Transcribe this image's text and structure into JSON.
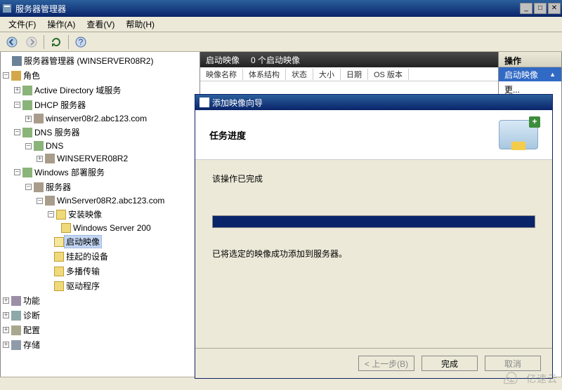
{
  "window": {
    "title": "服务器管理器"
  },
  "menu": {
    "file": "文件(F)",
    "action": "操作(A)",
    "view": "查看(V)",
    "help": "帮助(H)"
  },
  "tree": {
    "root": "服务器管理器 (WINSERVER08R2)",
    "roles": "角色",
    "ad": "Active Directory 域服务",
    "dhcp": "DHCP 服务器",
    "dhcp_host": "winserver08r2.abc123.com",
    "dns": "DNS 服务器",
    "dns_node": "DNS",
    "dns_host": "WINSERVER08R2",
    "wds": "Windows 部署服务",
    "servers": "服务器",
    "wds_host": "WinServer08R2.abc123.com",
    "install_images": "安装映像",
    "ws200x": "Windows Server 200",
    "boot_images": "启动映像",
    "pending": "挂起的设备",
    "multicast": "多播传输",
    "drivers": "驱动程序",
    "features": "功能",
    "diagnostics": "诊断",
    "config": "配置",
    "storage": "存储"
  },
  "list": {
    "header_kind": "启动映像",
    "header_count": "0 个启动映像",
    "cols": {
      "name": "映像名称",
      "arch": "体系结构",
      "status": "状态",
      "size": "大小",
      "date": "日期",
      "os": "OS 版本"
    }
  },
  "actions": {
    "title": "操作",
    "selected": "启动映像",
    "more": "更..."
  },
  "dialog": {
    "title": "添加映像向导",
    "heading": "任务进度",
    "complete": "该操作已完成",
    "detail": "已将选定的映像成功添加到服务器。",
    "back": "< 上一步(B)",
    "finish": "完成",
    "cancel": "取消"
  },
  "watermark": "亿速云"
}
